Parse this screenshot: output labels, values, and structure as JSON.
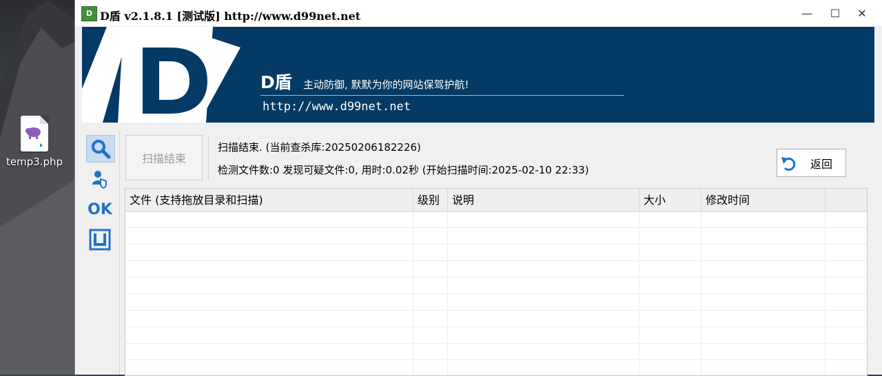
{
  "desktop": {
    "file_label": "temp3.php"
  },
  "window": {
    "title": "D盾 v2.1.8.1 [测试版] http://www.d99net.net",
    "icon_text": "D",
    "controls": {
      "minimize": "—",
      "maximize": "☐",
      "close": "✕"
    }
  },
  "banner": {
    "brand": "D盾",
    "slogan": "主动防御, 默默为你的网站保驾护航!",
    "url": "http://www.d99net.net",
    "bg_color": "#043a65"
  },
  "sidebar": {
    "items": [
      {
        "icon": "search-icon",
        "active": true
      },
      {
        "icon": "user-shield-icon",
        "active": false
      },
      {
        "icon": "ok-icon",
        "text": "OK",
        "active": false
      },
      {
        "icon": "square-frame-icon",
        "active": false
      }
    ]
  },
  "toolbar": {
    "scan_button": "扫描结束",
    "status_line1": "扫描结束. (当前查杀库:20250206182226)",
    "status_line2": "检测文件数:0 发现可疑文件:0, 用时:0.02秒 (开始扫描时间:2025-02-10 22:33)",
    "back_button": "返回"
  },
  "table": {
    "columns": [
      "文件 (支持拖放目录和扫描)",
      "级别",
      "说明",
      "大小",
      "修改时间"
    ],
    "rows": []
  }
}
